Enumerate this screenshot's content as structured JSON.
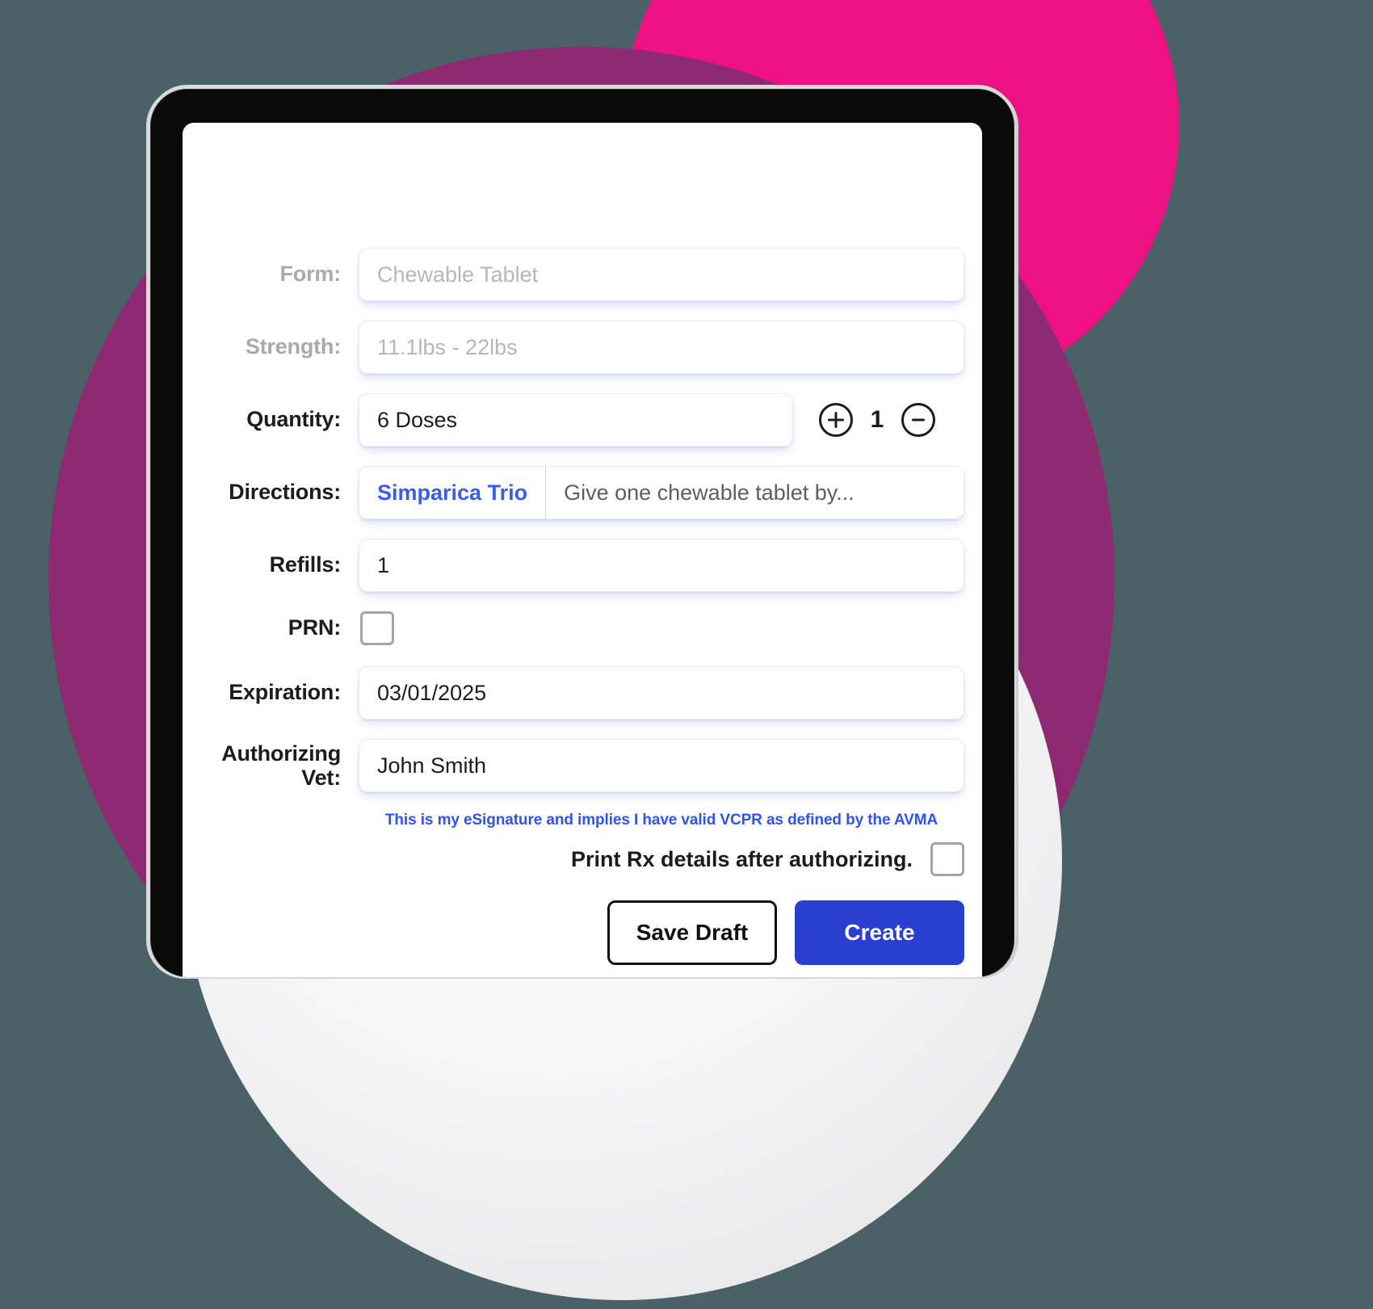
{
  "theme": {
    "background": "#4a6167",
    "blob_purple": "#8d2a72",
    "blob_magenta": "#ed1183",
    "accent_blue": "#2a3fd0",
    "link_blue": "#2f53f3",
    "text_dark": "#1c1c1e",
    "text_muted": "#a9a9b0"
  },
  "form": {
    "rows": [
      {
        "label": "Form:",
        "value": "Chewable Tablet",
        "state": "placeholder"
      },
      {
        "label": "Strength:",
        "value": "11.1lbs - 22lbs",
        "state": "placeholder"
      },
      {
        "label": "Quantity:",
        "value": "6 Doses",
        "state": "filled"
      },
      {
        "label": "Directions:",
        "drug_name": "Simparica Trio",
        "directions_text": "Give one chewable tablet by...",
        "state": "filled"
      },
      {
        "label": "Refills:",
        "value": "1",
        "state": "filled"
      },
      {
        "label": "PRN:",
        "checked": false
      },
      {
        "label": "Expiration:",
        "value": "03/01/2025",
        "state": "filled"
      },
      {
        "label": "Authorizing Vet:",
        "label_line1": "Authorizing",
        "label_line2": "Vet:",
        "value": "John Smith",
        "state": "filled"
      }
    ],
    "quantity_stepper": {
      "increment_icon": "plus-circle-icon",
      "value": "1",
      "decrement_icon": "minus-circle-icon"
    },
    "esignature_note": "This is my eSignature and implies I have valid VCPR as defined by the AVMA",
    "print_option": {
      "label": "Print Rx details after authorizing.",
      "checked": false
    },
    "actions": {
      "secondary_label": "Save Draft",
      "primary_label": "Create"
    }
  }
}
